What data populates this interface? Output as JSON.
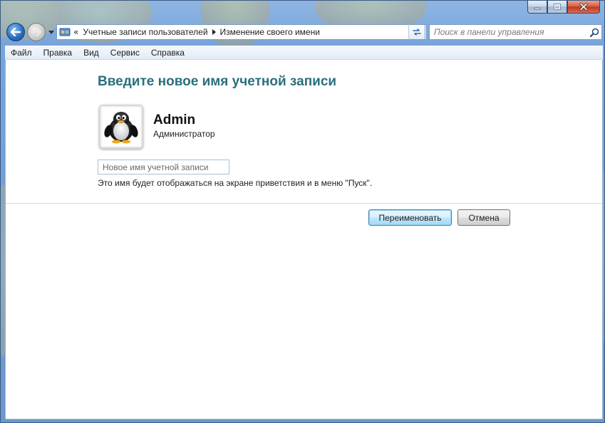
{
  "window": {
    "caption_buttons": [
      "minimize-icon",
      "maximize-icon",
      "close-icon"
    ]
  },
  "navbar": {
    "breadcrumb": [
      "Учетные записи пользователей",
      "Изменение своего имени"
    ],
    "overflow_chevron": "«",
    "search_placeholder": "Поиск в панели управления"
  },
  "menu": {
    "items": [
      "Файл",
      "Правка",
      "Вид",
      "Сервис",
      "Справка"
    ]
  },
  "main": {
    "heading": "Введите новое имя учетной записи",
    "user": {
      "name": "Admin",
      "role": "Администратор",
      "avatar_icon": "penguin-icon"
    },
    "name_input_placeholder": "Новое имя учетной записи",
    "hint": "Это имя будет отображаться на экране приветствия и в меню \"Пуск\".",
    "rename_label": "Переименовать",
    "cancel_label": "Отмена"
  },
  "colors": {
    "heading": "#2a6f7c",
    "primary_button_border": "#3c7fb1",
    "window_glass": "#9cc0e8"
  }
}
